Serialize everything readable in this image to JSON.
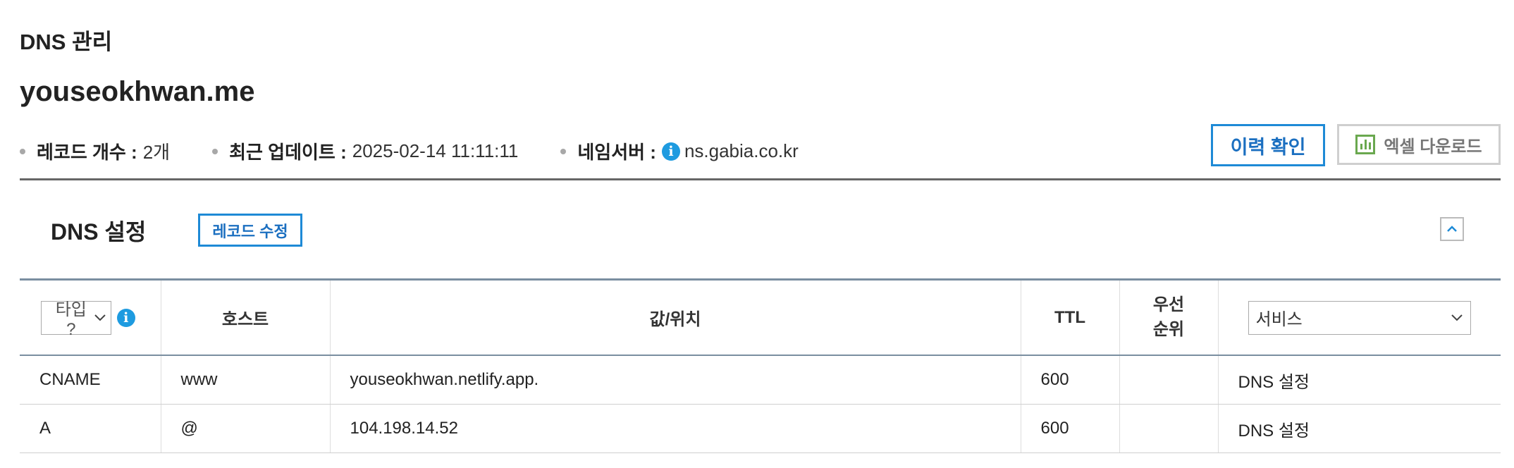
{
  "page": {
    "breadcrumb": "DNS 관리",
    "domain": "youseokhwan.me"
  },
  "meta": {
    "record_count_label": "레코드 개수 :",
    "record_count_value": "2개",
    "updated_label": "최근 업데이트 :",
    "updated_value": "2025-02-14 11:11:11",
    "nameserver_label": "네임서버 :",
    "nameserver_value": "ns.gabia.co.kr"
  },
  "buttons": {
    "history": "이력 확인",
    "excel": "엑셀 다운로드"
  },
  "section": {
    "title": "DNS 설정",
    "edit_button": "레코드 수정"
  },
  "table": {
    "type_select_value": "타입 ?",
    "headers": {
      "host": "호스트",
      "value": "값/위치",
      "ttl": "TTL",
      "priority_line1": "우선",
      "priority_line2": "순위"
    },
    "service_select_value": "서비스",
    "rows": [
      {
        "type": "CNAME",
        "host": "www",
        "value": "youseokhwan.netlify.app.",
        "ttl": "600",
        "priority": "",
        "service": "DNS 설정"
      },
      {
        "type": "A",
        "host": "@",
        "value": "104.198.14.52",
        "ttl": "600",
        "priority": "",
        "service": "DNS 설정"
      }
    ]
  },
  "icons": {
    "info": "info-icon",
    "excel": "excel-chart-icon",
    "collapse": "chevron-up-icon",
    "dropdown": "chevron-down-icon"
  },
  "colors": {
    "accent_blue": "#1e8ad6",
    "info_blue": "#1e9be0",
    "excel_green": "#6aa84f",
    "table_rule": "#7a8ea0"
  }
}
